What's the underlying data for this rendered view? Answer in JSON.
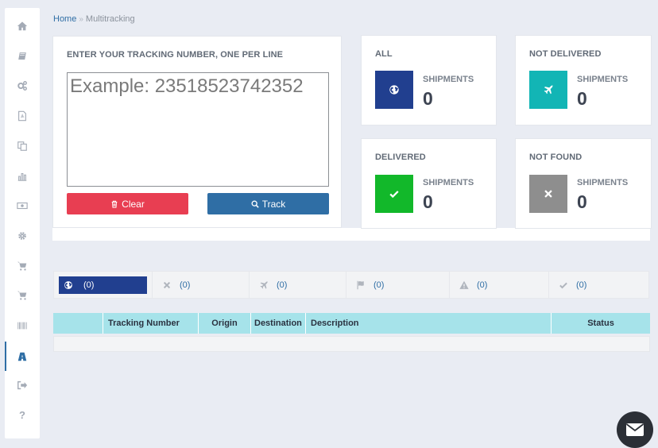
{
  "breadcrumb": {
    "home": "Home",
    "separator": "»",
    "current": "Multitracking"
  },
  "sidebar": {
    "items": [
      {
        "icon": "home-icon"
      },
      {
        "icon": "book-icon"
      },
      {
        "icon": "gears-icon"
      },
      {
        "icon": "pdf-file-icon"
      },
      {
        "icon": "copy-icon"
      },
      {
        "icon": "bar-chart-icon"
      },
      {
        "icon": "money-icon"
      },
      {
        "icon": "gear-icon"
      },
      {
        "icon": "cart-icon"
      },
      {
        "icon": "cart-icon"
      },
      {
        "icon": "barcode-icon"
      },
      {
        "icon": "road-icon",
        "active": true
      },
      {
        "icon": "sign-out-icon"
      },
      {
        "icon": "question-icon",
        "label": "?"
      }
    ]
  },
  "tracking": {
    "label": "ENTER YOUR TRACKING NUMBER, ONE PER LINE",
    "placeholder": "Example: 23518523742352",
    "value": "",
    "clear_label": "Clear",
    "track_label": "Track"
  },
  "stats": {
    "all": {
      "title": "ALL",
      "sub": "SHIPMENTS",
      "count": "0",
      "color": "#213f8f",
      "icon": "globe-icon"
    },
    "not_delivered": {
      "title": "NOT DELIVERED",
      "sub": "SHIPMENTS",
      "count": "0",
      "color": "#12b5b5",
      "icon": "plane-icon"
    },
    "delivered": {
      "title": "DELIVERED",
      "sub": "SHIPMENTS",
      "count": "0",
      "color": "#12b82a",
      "icon": "check-icon"
    },
    "not_found": {
      "title": "NOT FOUND",
      "sub": "SHIPMENTS",
      "count": "0",
      "color": "#8e8e8e",
      "icon": "x-icon"
    }
  },
  "tabs": [
    {
      "icon": "globe-icon",
      "count": "(0)",
      "active": true
    },
    {
      "icon": "x-icon",
      "count": "(0)"
    },
    {
      "icon": "plane-icon",
      "count": "(0)"
    },
    {
      "icon": "flag-icon",
      "count": "(0)"
    },
    {
      "icon": "warning-icon",
      "count": "(0)"
    },
    {
      "icon": "check-icon",
      "count": "(0)"
    }
  ],
  "table": {
    "columns": [
      "",
      "Tracking Number",
      "Origin",
      "Destination",
      "Description",
      "Status"
    ],
    "rows": []
  },
  "chat": {
    "icon": "mail-icon"
  }
}
